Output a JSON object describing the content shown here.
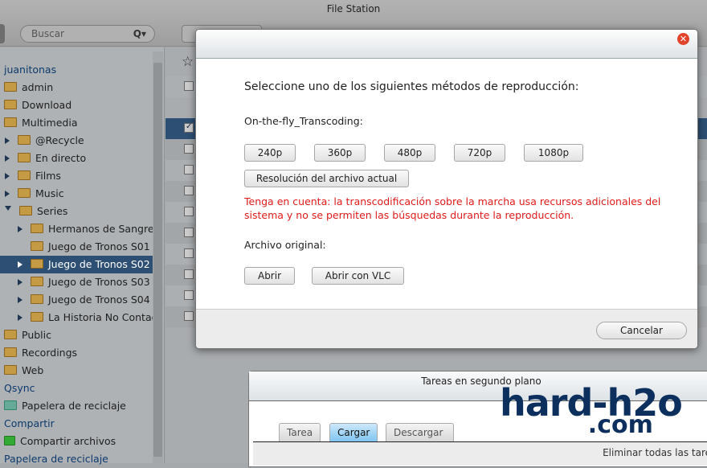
{
  "window": {
    "title": "File Station"
  },
  "toolbar": {
    "search_placeholder": "Buscar"
  },
  "sidebar": {
    "items": [
      {
        "label": "juanitonas",
        "type": "head"
      },
      {
        "label": "admin",
        "type": "folder",
        "level": 0
      },
      {
        "label": "Download",
        "type": "folder",
        "level": 0
      },
      {
        "label": "Multimedia",
        "type": "folder",
        "level": 0
      },
      {
        "label": "@Recycle",
        "type": "folder",
        "level": 1,
        "expander": "closed"
      },
      {
        "label": "En directo",
        "type": "folder",
        "level": 1,
        "expander": "closed"
      },
      {
        "label": "Films",
        "type": "folder",
        "level": 1,
        "expander": "closed"
      },
      {
        "label": "Music",
        "type": "folder",
        "level": 1,
        "expander": "closed"
      },
      {
        "label": "Series",
        "type": "folder",
        "level": 1,
        "expander": "open"
      },
      {
        "label": "Hermanos de Sangre",
        "type": "folder",
        "level": 2,
        "expander": "closed"
      },
      {
        "label": "Juego de Tronos S01",
        "type": "folder",
        "level": 2
      },
      {
        "label": "Juego de Tronos S02",
        "type": "folder",
        "level": 2,
        "expander": "closed",
        "selected": true
      },
      {
        "label": "Juego de Tronos S03",
        "type": "folder",
        "level": 2,
        "expander": "closed"
      },
      {
        "label": "Juego de Tronos S04",
        "type": "folder",
        "level": 2,
        "expander": "closed"
      },
      {
        "label": "La Historia No Contad",
        "type": "folder",
        "level": 2,
        "expander": "closed"
      },
      {
        "label": "Public",
        "type": "folder",
        "level": 0
      },
      {
        "label": "Recordings",
        "type": "folder",
        "level": 0
      },
      {
        "label": "Web",
        "type": "folder",
        "level": 0
      },
      {
        "label": "Qsync",
        "type": "head"
      },
      {
        "label": "Papelera de reciclaje",
        "type": "recycle",
        "level": 0
      },
      {
        "label": "Compartir",
        "type": "head"
      },
      {
        "label": "Compartir archivos",
        "type": "share",
        "level": 0
      },
      {
        "label": "Papelera de reciclaje",
        "type": "head"
      }
    ]
  },
  "dialog": {
    "prompt": "Seleccione uno de los siguientes métodos de reproducción:",
    "transcoding_label": "On-the-fly_Transcoding:",
    "resolutions": [
      "240p",
      "360p",
      "480p",
      "720p",
      "1080p"
    ],
    "current_resolution": "Resolución del archivo actual",
    "warning": "Tenga en cuenta: la transcodificación sobre la marcha usa recursos adicionales del sistema y no se permiten las búsquedas durante la reproducción.",
    "original_label": "Archivo original:",
    "open": "Abrir",
    "open_vlc": "Abrir con VLC",
    "cancel": "Cancelar"
  },
  "background_tasks": {
    "title": "Tareas en segundo plano",
    "tabs": [
      "Tarea",
      "Cargar",
      "Descargar"
    ],
    "active_tab": "Cargar",
    "clear_all": "Eliminar todas las tare"
  },
  "watermark": {
    "line1": "hard-h2o",
    "line2": ".com"
  }
}
